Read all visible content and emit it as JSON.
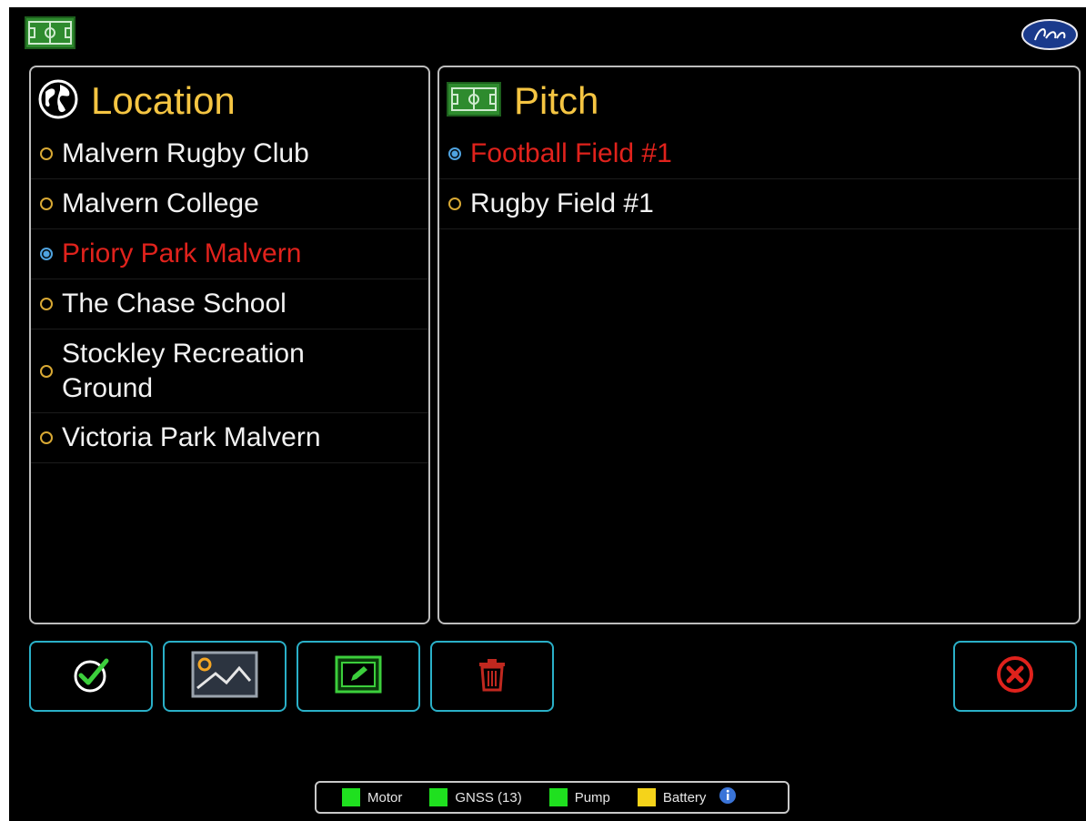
{
  "location_panel": {
    "title": "Location",
    "items": [
      {
        "label": "Malvern Rugby Club",
        "selected": false
      },
      {
        "label": "Malvern College",
        "selected": false
      },
      {
        "label": "Priory Park Malvern",
        "selected": true
      },
      {
        "label": "The Chase School",
        "selected": false
      },
      {
        "label": "Stockley Recreation Ground",
        "selected": false
      },
      {
        "label": "Victoria Park Malvern",
        "selected": false
      }
    ]
  },
  "pitch_panel": {
    "title": "Pitch",
    "items": [
      {
        "label": "Football Field #1",
        "selected": true
      },
      {
        "label": "Rugby Field #1",
        "selected": false
      }
    ]
  },
  "toolbar": {
    "buttons": [
      "check-icon",
      "map-image-icon",
      "edit-icon",
      "trash-icon",
      "close-icon"
    ]
  },
  "status_bar": {
    "items": [
      {
        "label": "Motor",
        "color": "#1fe01f"
      },
      {
        "label": "GNSS (13)",
        "color": "#1fe01f"
      },
      {
        "label": "Pump",
        "color": "#1fe01f"
      },
      {
        "label": "Battery",
        "color": "#f5d31a"
      }
    ]
  },
  "colors": {
    "accent": "#f5c542",
    "selected_text": "#e0221c",
    "button_border": "#2ab0c8"
  }
}
